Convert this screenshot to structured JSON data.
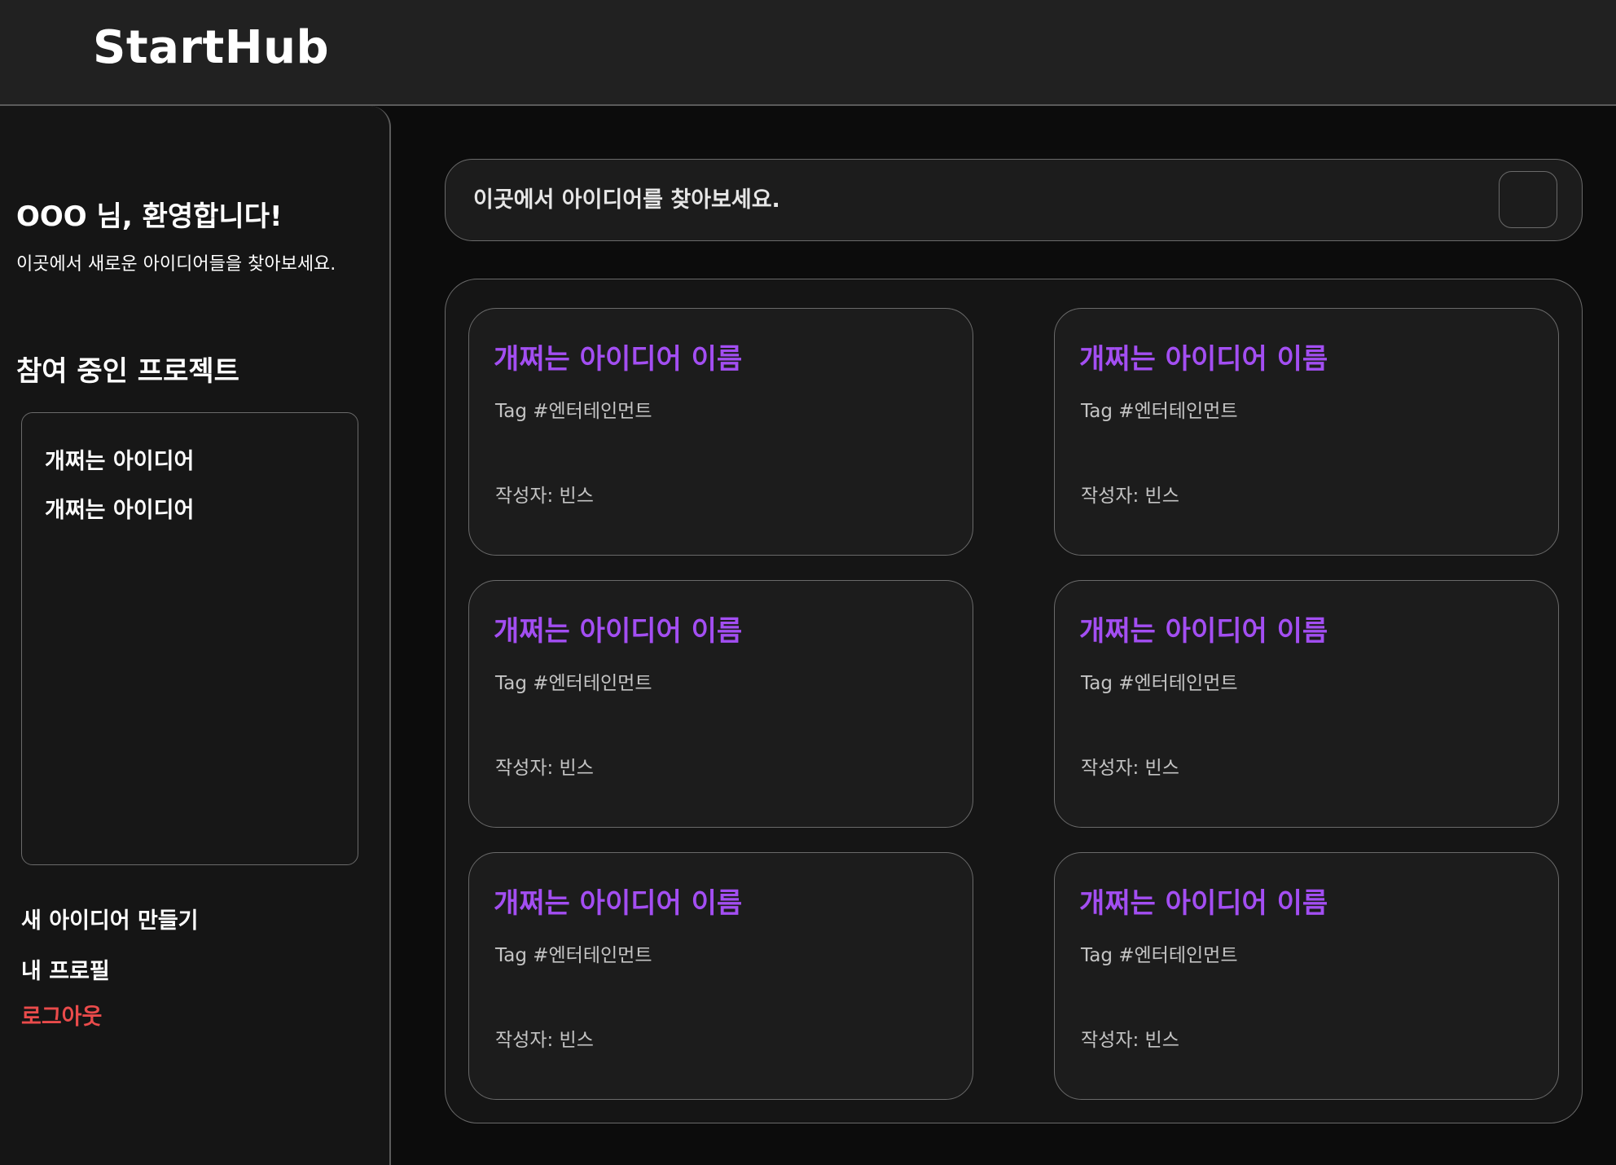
{
  "header": {
    "logo": "StartHub"
  },
  "sidebar": {
    "welcome_title": "OOO 님, 환영합니다!",
    "welcome_subtitle": "이곳에서 새로운 아이디어들을 찾아보세요.",
    "projects_heading": "참여 중인 프로젝트",
    "projects": [
      {
        "label": "개쩌는 아이디어"
      },
      {
        "label": "개쩌는 아이디어"
      }
    ],
    "nav": {
      "new_idea": "새 아이디어 만들기",
      "profile": "내 프로필",
      "logout": "로그아웃"
    }
  },
  "search": {
    "placeholder": "이곳에서 아이디어를 찾아보세요.",
    "value": ""
  },
  "cards": [
    {
      "title": "개쩌는 아이디어 이름",
      "tag": "Tag #엔터테인먼트",
      "author": "작성자: 빈스"
    },
    {
      "title": "개쩌는 아이디어 이름",
      "tag": "Tag #엔터테인먼트",
      "author": "작성자: 빈스"
    },
    {
      "title": "개쩌는 아이디어 이름",
      "tag": "Tag #엔터테인먼트",
      "author": "작성자: 빈스"
    },
    {
      "title": "개쩌는 아이디어 이름",
      "tag": "Tag #엔터테인먼트",
      "author": "작성자: 빈스"
    },
    {
      "title": "개쩌는 아이디어 이름",
      "tag": "Tag #엔터테인먼트",
      "author": "작성자: 빈스"
    },
    {
      "title": "개쩌는 아이디어 이름",
      "tag": "Tag #엔터테인먼트",
      "author": "작성자: 빈스"
    }
  ],
  "colors": {
    "accent_title": "#a34ef2",
    "logout": "#ea4b4b",
    "header_bg": "#212121",
    "page_bg": "#0c0c0c"
  }
}
